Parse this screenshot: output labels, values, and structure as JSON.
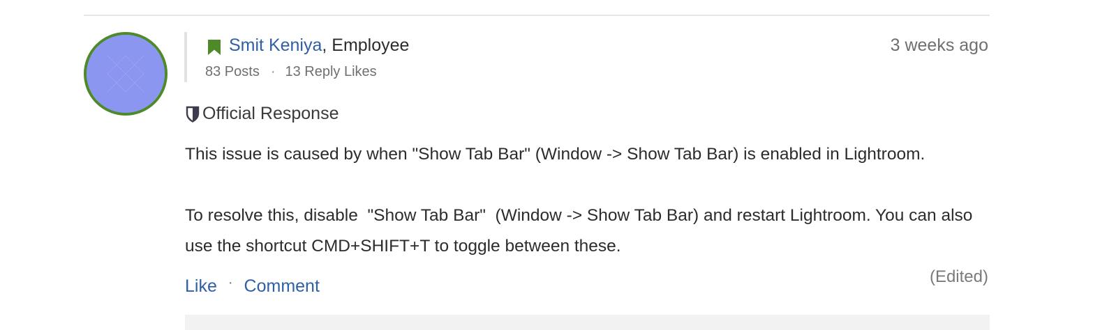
{
  "post": {
    "author": {
      "name": "Smit Keniya",
      "role_suffix": ", Employee",
      "rank_icon": "bookmark-icon",
      "avatar_colors": {
        "ring": "#4e8a2a",
        "fill": "#8b96f0"
      }
    },
    "stats": {
      "posts": "83 Posts",
      "separator": "·",
      "reply_likes": "13 Reply Likes"
    },
    "timestamp": "3 weeks ago",
    "badge": {
      "icon": "shield-icon",
      "label": "Official Response"
    },
    "body": {
      "paragraph_1": "This issue is caused by when \"Show Tab Bar\" (Window -> Show Tab Bar) is enabled in Lightroom.",
      "paragraph_2": "To resolve this, disable  \"Show Tab Bar\"  (Window -> Show Tab Bar) and restart Lightroom. You can also use the shortcut CMD+SHIFT+T to toggle between these."
    },
    "actions": {
      "like_label": "Like",
      "separator": "·",
      "comment_label": "Comment"
    },
    "edited_label": "(Edited)"
  },
  "colors": {
    "link": "#2f5fa5",
    "rank_green": "#4e8a2a",
    "muted_text": "#6f6f6f"
  }
}
